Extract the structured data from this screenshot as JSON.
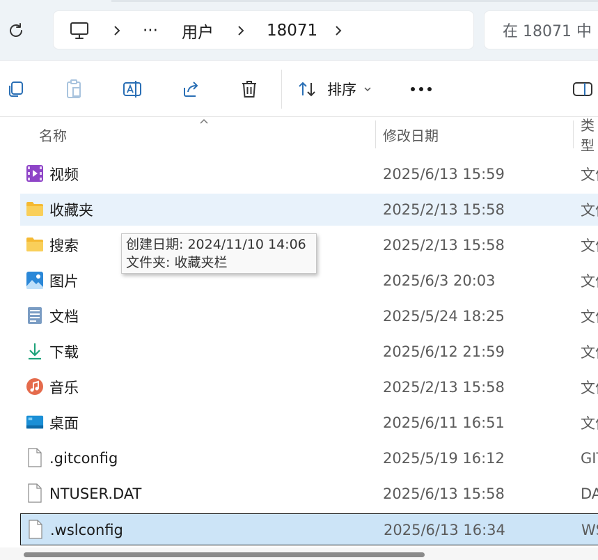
{
  "address": {
    "crumbs": [
      "用户",
      "18071"
    ],
    "ellipsis": "···",
    "search_placeholder": "在 18071 中"
  },
  "toolbar": {
    "sort_label": "排序",
    "more_label": "•••"
  },
  "columns": {
    "name": "名称",
    "modified": "修改日期",
    "type": "类型"
  },
  "files": [
    {
      "name": "视频",
      "date": "2025/6/13 15:59",
      "type": "文件夹",
      "icon": "videos-folder-icon"
    },
    {
      "name": "收藏夹",
      "date": "2025/2/13 15:58",
      "type": "文件夹",
      "icon": "folder-icon"
    },
    {
      "name": "搜索",
      "date": "2025/2/13 15:58",
      "type": "文件夹",
      "icon": "folder-icon"
    },
    {
      "name": "图片",
      "date": "2025/6/3 20:03",
      "type": "文件夹",
      "icon": "pictures-folder-icon"
    },
    {
      "name": "文档",
      "date": "2025/5/24 18:25",
      "type": "文件夹",
      "icon": "documents-folder-icon"
    },
    {
      "name": "下载",
      "date": "2025/6/12 21:59",
      "type": "文件夹",
      "icon": "downloads-folder-icon"
    },
    {
      "name": "音乐",
      "date": "2025/2/13 15:58",
      "type": "文件夹",
      "icon": "music-folder-icon"
    },
    {
      "name": "桌面",
      "date": "2025/6/11 16:51",
      "type": "文件夹",
      "icon": "desktop-folder-icon"
    },
    {
      "name": ".gitconfig",
      "date": "2025/5/19 16:12",
      "type": "GIT",
      "icon": "file-icon"
    },
    {
      "name": "NTUSER.DAT",
      "date": "2025/6/13 15:58",
      "type": "DA",
      "icon": "file-icon"
    },
    {
      "name": ".wslconfig",
      "date": "2025/6/13 16:34",
      "type": "WS",
      "icon": "file-icon"
    }
  ],
  "tooltip": {
    "line1": "创建日期: 2024/11/10 14:06",
    "line2": "文件夹: 收藏夹栏"
  },
  "colors": {
    "hover_row": "#e8f2fb",
    "selected_row": "#cce4f7",
    "folder_yellow": "#f7c948"
  }
}
